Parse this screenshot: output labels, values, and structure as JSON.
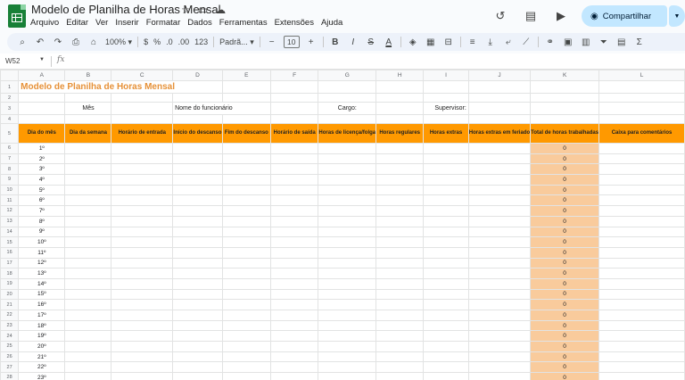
{
  "app": {
    "title": "Modelo de Planilha de Horas Mensal",
    "menu": [
      "Arquivo",
      "Editar",
      "Ver",
      "Inserir",
      "Formatar",
      "Dados",
      "Ferramentas",
      "Extensões",
      "Ajuda"
    ],
    "share_label": "Compartilhar"
  },
  "toolbar": {
    "zoom": "100%",
    "currency": "$",
    "percent": "%",
    "decimal_dec": ".0",
    "decimal_inc": ".00",
    "number_format": "123",
    "font": "Padrã...",
    "font_size": "10",
    "bold": "B",
    "italic": "I",
    "text_color": "A"
  },
  "formula_bar": {
    "name_box": "W52",
    "fx": "fx"
  },
  "sheet": {
    "columns": [
      "A",
      "B",
      "C",
      "D",
      "E",
      "F",
      "G",
      "H",
      "I",
      "J",
      "K",
      "L"
    ],
    "title": "Modelo de Planilha de Horas Mensal",
    "labels": {
      "month": "Mês",
      "employee": "Nome do funcionário",
      "role": "Cargo:",
      "supervisor": "Supervisor:"
    },
    "headers": [
      "Dia do mês",
      "Dia da semana",
      "Horário de entrada",
      "Início do descanso",
      "Fim do descanso",
      "Horário de saída",
      "Horas de licença/folga",
      "Horas regulares",
      "Horas extras",
      "Horas extras em feriado",
      "Total de horas trabalhadas",
      "Caixa para comentários"
    ],
    "row_numbers": [
      "1",
      "2",
      "3",
      "4",
      "5",
      "6",
      "7",
      "8",
      "9",
      "10",
      "11",
      "12",
      "13",
      "14",
      "15",
      "16",
      "17",
      "18",
      "19",
      "20",
      "21",
      "22",
      "23",
      "24",
      "25",
      "26",
      "27",
      "28"
    ],
    "days": [
      "1º",
      "2º",
      "3º",
      "4º",
      "5º",
      "6º",
      "7º",
      "8º",
      "9º",
      "10º",
      "11º",
      "12º",
      "13º",
      "14º",
      "15º",
      "16º",
      "17º",
      "18º",
      "19º",
      "20º",
      "21º",
      "22º",
      "23º"
    ],
    "totals": [
      "0",
      "0",
      "0",
      "0",
      "0",
      "0",
      "0",
      "0",
      "0",
      "0",
      "0",
      "0",
      "0",
      "0",
      "0",
      "0",
      "0",
      "0",
      "0",
      "0",
      "0",
      "0",
      "0"
    ]
  },
  "colors": {
    "header_fill": "#ff9900",
    "total_fill": "#f9cb9c",
    "title_text": "#e69138",
    "share_button": "#c2e7ff"
  }
}
